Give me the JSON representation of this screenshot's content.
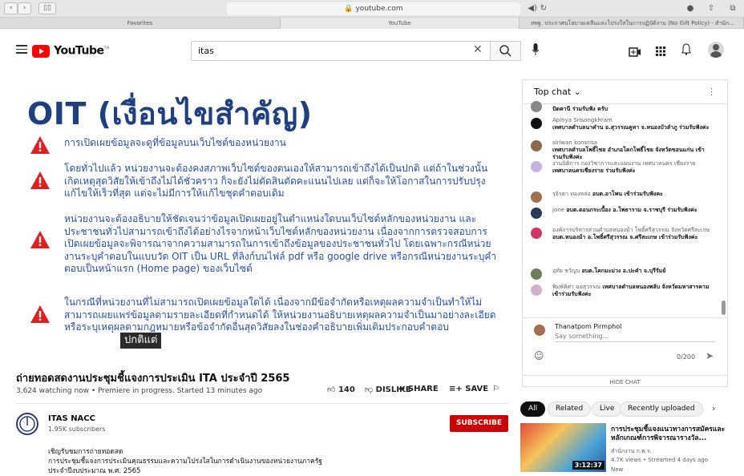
{
  "browser": {
    "address": "youtube.com",
    "tabs": [
      "Favorites",
      "YouTube",
      "สพฐ. ประกาศนโยบายเคลีนและไปร่งใสในการปฏิบัติงาน (No Gift Policy) - สำนัก..."
    ]
  },
  "header": {
    "logo_text": "YouTube",
    "logo_sup": "TH",
    "search_value": "itas"
  },
  "video": {
    "slide_title": "OIT (เงื่อนไขสำคัญ)",
    "items": [
      "การเปิดเผยข้อมูลจะดูที่ข้อมูลบนเว็บไซต์ของหน่วยงาน",
      "โดยทั่วไปแล้ว หน่วยงานจะต้องคงสภาพเว็บไซต์ของตนเองให้สามารถเข้าถึงได้เป็นปกติ แต่ถ้าในช่วงนั้นเกิดเหตุสุดวิสัยให้เข้าถึงไม่ได้ชั่วคราว ก็จะยังไม่ตัดสินตัดคะแนนไปเลย แต่ก็จะให้โอกาสในการปรับปรุงแก้ไขให้เร็วที่สุด แต่จะไม่มีการให้แก้ไขชุดคำตอบเดิม",
      "หน่วยงานจะต้องอธิบายให้ชัดเจนว่าข้อมูลเปิดเผยอยู่ในตำแหน่งใดบนเว็บไซต์หลักของหน่วยงาน และประชาชนทั่วไปสามารถเข้าถึงได้อย่างไรจากหน้าเว็บไซต์หลักของหน่วยงาน เนื่องจากการตรวจสอบการเปิดเผยข้อมูลจะพิจารณาจากความสามารถในการเข้าถึงข้อมูลของประชาชนทั่วไป โดยเฉพาะกรณีหน่วยงานระบุคำตอบในแบบวัด OIT เป็น URL ที่ลิงก์บนไฟล์ pdf หรือ google drive หรือกรณีหน่วยงานระบุคำตอบเป็นหน้าแรก (Home page) ของเว็บไซต์",
      "ในกรณีที่หน่วยงานที่ไม่สามารถเปิดเผยข้อมูลใดได้ เนื่องจากมีข้อจำกัดหรือเหตุผลความจำเป็นทำให้ไม่สามารถเผยแพร่ข้อมูลตามรายละเอียดที่กำหนดได้ ให้หน่วยงานอธิบายเหตุผลความจำเป็นมาอย่างละเอียดหรือระบุเหตุผลตามกฎหมายหรือข้อจำกัดอื่นสุดวิสัยลงในช่องคำอธิบายเพิ่มเติมประกอบคำตอบ"
    ],
    "caption": "ปกติแต่",
    "title": "ถ่ายทอดสดงานประชุมชี้แจงการประเมิน ITA ประจำปี 2565",
    "meta": "3,624 watching now • Premiere in progress. Started 13 minutes ago",
    "likes": "140",
    "dislike": "DISLIKE",
    "share": "SHARE",
    "save": "SAVE"
  },
  "channel": {
    "name": "ITAS NACC",
    "subscribers": "1.95K subscribers",
    "subscribe": "SUBSCRIBE",
    "desc": [
      "เชิญรับชมการถ่ายทอดสด",
      "การประชุมชี้แจงการประเมินคุณธรรมและความโปร่งใสในการดำเนินงานของหน่วยงานภาครัฐ",
      "ประจำปีงบประมาณ พ.ศ. 2565"
    ]
  },
  "chat": {
    "header": "Top chat",
    "messages": [
      {
        "name": "",
        "text": "ปัดคานี ร่วมรับฟัง ครับ",
        "color": "#888888"
      },
      {
        "name": "Apinya Srisongkhram",
        "text": "เทศบาลตำบลนาคำน อ.สุวรรณคูหา จ.หนองบัวลำภู ร่วมรับฟังค่ะ",
        "color": "#111111"
      },
      {
        "name": "siriwan konsrisa",
        "text": "เทศบาลตำบลโพธิ์ไชย อำเภอโคกโพธิ์ไชย จังหวัดขอนแก่น เข้าร่วมรับฟังค่ะ",
        "color": "#8a6a4a"
      },
      {
        "name": "งานนิติการ กองวิชาการและแผนงาน เทศบาลนคร เชียงราย",
        "text": "เทศบาลนครเชียงราย ร่วมรับฟังค่ะ",
        "color": "#c7b2e0"
      },
      {
        "name": "รุจิรดา ทองหล่อ",
        "text": "อบต.อาโพน เข้าร่วมรับฟังคะ",
        "color": "#a07050"
      },
      {
        "name": "jone",
        "text": "อบต.ดอนกระเบื้อง อ.โพธาราม จ.ราชบุรี ร่วมรับฟังค่ะ",
        "color": "#2b3a55"
      },
      {
        "name": "องค์การบริหารส่วนตำบลหนองม้า โพธิ์ศรีสุวรรณ จังหวัดศรีสะเกษ",
        "text": "อบต.หนองม้า อ.โพธิ์ศรีสุวรรณ จ.ศรีสะเกษ เข้าร่วมรับฟังค่ะ",
        "color": "#d0356a"
      },
      {
        "name": "อุทัย ชวัญบ",
        "text": "อบต.โคกมะม่วง อ.ปะคำ จ.บุรีรัมย์",
        "color": "#6a7f5a"
      },
      {
        "name": "พิมพ์ทิศา ฉยสุวรรณ",
        "text": "เทศบาลตำบลหนองพลับ จังหวัดมหาสารคาม เข้าร่วมรับฟังค่ะ",
        "color": "#d3b0c9"
      }
    ],
    "input_user": "Thanatpom Pirmphol",
    "input_placeholder": "Say something...",
    "counter": "0/200",
    "hide": "HIDE CHAT"
  },
  "chips": [
    "All",
    "Related",
    "Live",
    "Recently uploaded"
  ],
  "related": {
    "title": "การประชุมชี้แจงแนวทางการสมัครและหลักเกณฑ์การพิจารณารางวัล...",
    "channel": "สำนักงาน ก.พ.ร.",
    "views": "4.7K views • Streamed 4 days ago",
    "badge": "New",
    "duration": "3:12:37"
  },
  "colors": {
    "accent": "#cc0000",
    "slide_title": "#1e3f82",
    "slide_text": "#2a4f9c"
  }
}
